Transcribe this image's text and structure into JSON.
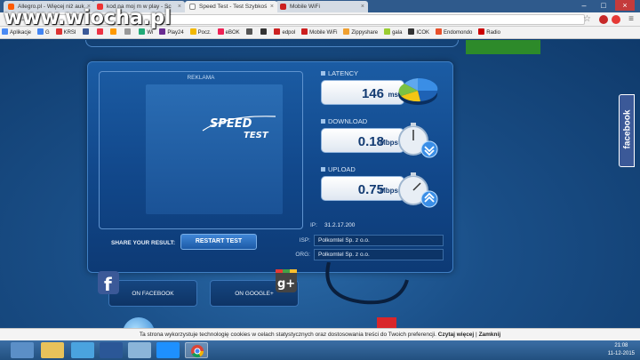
{
  "watermark": "www.wiocha.pl",
  "browser": {
    "tabs": [
      {
        "label": "Allegro.pl - Więcej niż auk",
        "favicon_color": "#ff5a00"
      },
      {
        "label": "kod na moj m w play - Sc",
        "favicon_color": "#e33"
      },
      {
        "label": "Speed Test - Test Szybkoś",
        "favicon_color": "#888",
        "active": true
      },
      {
        "label": "Mobile WiFi",
        "favicon_color": "#cc1f1f"
      }
    ],
    "bookmarks": [
      {
        "label": "Aplikacje",
        "color": "#4a8af4"
      },
      {
        "label": "G",
        "color": "#4285f4"
      },
      {
        "label": "KRSI",
        "color": "#d33"
      },
      {
        "label": "",
        "color": "#3b5998"
      },
      {
        "label": "",
        "color": "#e34"
      },
      {
        "label": "",
        "color": "#f90"
      },
      {
        "label": "",
        "color": "#999"
      },
      {
        "label": "Wi",
        "color": "#2a7"
      },
      {
        "label": "Play24",
        "color": "#6a2c91"
      },
      {
        "label": "Pocz.",
        "color": "#f3b800"
      },
      {
        "label": "eBOK",
        "color": "#e25"
      },
      {
        "label": "",
        "color": "#555"
      },
      {
        "label": "",
        "color": "#333"
      },
      {
        "label": "edpol",
        "color": "#c22"
      },
      {
        "label": "Mobile WiFi",
        "color": "#cc1f1f"
      },
      {
        "label": "Zippyshare",
        "color": "#f0a030"
      },
      {
        "label": "gala",
        "color": "#9acd32"
      },
      {
        "label": "ICOK",
        "color": "#333"
      },
      {
        "label": "Endomondo",
        "color": "#e8502a"
      },
      {
        "label": "Radio",
        "color": "#c00"
      }
    ]
  },
  "speedtest": {
    "ad_label": "REKLAMA",
    "logo_line1": "SPEED",
    "logo_line2": "TEST",
    "latency": {
      "title": "LATENCY",
      "value": "146",
      "unit": "ms"
    },
    "download": {
      "title": "DOWNLOAD",
      "value": "0.18",
      "unit": "Mbps"
    },
    "upload": {
      "title": "UPLOAD",
      "value": "0.75",
      "unit": "Mbps"
    },
    "ip_label": "IP:",
    "ip": "31.2.17.200",
    "share_label": "SHARE YOUR RESULT:",
    "restart_label": "RESTART TEST",
    "isp_label": "ISP:",
    "isp": "Polkomtel Sp. z o.o.",
    "org_label": "ORG:",
    "org": "Polkomtel Sp. z o.o.",
    "facebook_button": "ON FACEBOOK",
    "google_button": "ON GOOGLE+"
  },
  "facebook_tab": "facebook",
  "cookie_bar": {
    "text": "Ta strona wykorzystuje technologię cookies w celach statystycznych oraz dostosowania treści do Twoich preferencji.",
    "more": "Czytaj więcej",
    "sep": "|",
    "close": "Zamknij"
  },
  "taskbar": {
    "time": "21:08",
    "date": "11-12-2015"
  }
}
